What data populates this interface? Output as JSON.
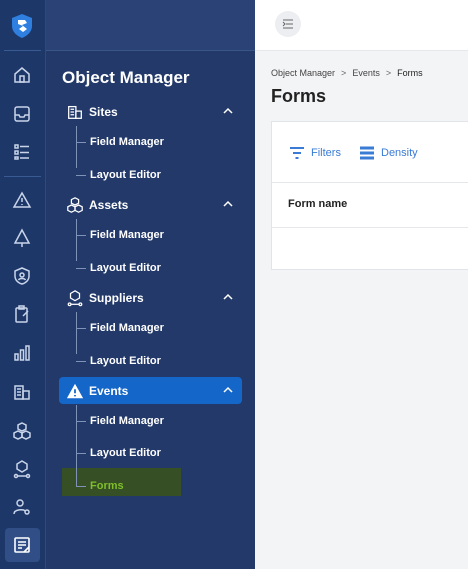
{
  "rail": {
    "logo_icon": "shield-logo-icon",
    "icons": [
      "home-icon",
      "inbox-icon",
      "list-icon",
      "alert-triangle-icon",
      "tree-alert-icon",
      "shield-user-icon",
      "clipboard-icon",
      "bar-chart-icon",
      "buildings-icon",
      "cubes-icon",
      "supplier-cube-icon",
      "user-settings-icon",
      "form-icon"
    ]
  },
  "nav": {
    "title": "Object Manager",
    "sections": [
      {
        "label": "Sites",
        "icon": "buildings-icon",
        "items": [
          "Field Manager",
          "Layout Editor"
        ]
      },
      {
        "label": "Assets",
        "icon": "cubes-icon",
        "items": [
          "Field Manager",
          "Layout Editor"
        ]
      },
      {
        "label": "Suppliers",
        "icon": "supplier-cube-icon",
        "items": [
          "Field Manager",
          "Layout Editor"
        ]
      },
      {
        "label": "Events",
        "icon": "alert-triangle-icon",
        "active": true,
        "items": [
          "Field Manager",
          "Layout Editor",
          "Forms"
        ]
      }
    ]
  },
  "breadcrumb": {
    "items": [
      "Object Manager",
      "Events",
      "Forms"
    ],
    "separator": ">"
  },
  "page": {
    "title": "Forms"
  },
  "toolbar": {
    "filters_label": "Filters",
    "density_label": "Density"
  },
  "table": {
    "columns": [
      "Form name"
    ]
  },
  "colors": {
    "rail_bg": "#1d3868",
    "nav_bg": "#22396a",
    "active_bg": "#1566c9",
    "link_blue": "#3a7bd5",
    "highlight_green": "#7fbf2a"
  }
}
